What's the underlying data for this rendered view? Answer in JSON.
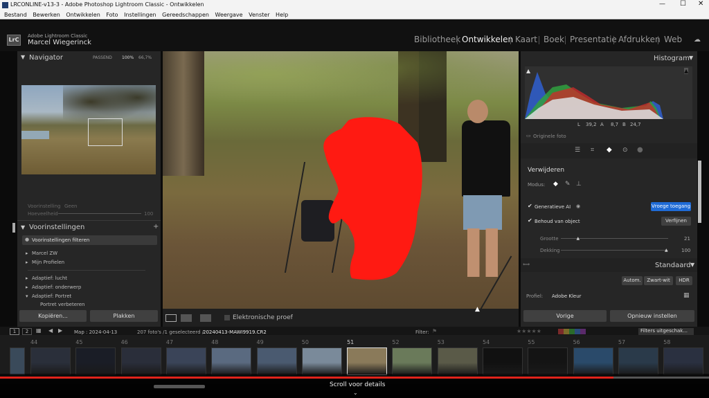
{
  "title": "LRCONLINE-v13-3 - Adobe Photoshop Lightroom Classic - Ontwikkelen",
  "menu": [
    "Bestand",
    "Bewerken",
    "Ontwikkelen",
    "Foto",
    "Instellingen",
    "Gereedschappen",
    "Weergave",
    "Venster",
    "Help"
  ],
  "app": {
    "product": "Adobe Lightroom Classic",
    "user": "Marcel Wiegerinck",
    "logo": "LrC"
  },
  "modules": [
    "Bibliotheek",
    "Ontwikkelen",
    "Kaart",
    "Boek",
    "Presentatie",
    "Afdrukken",
    "Web"
  ],
  "navigator": {
    "title": "Navigator",
    "fit": "PASSEND",
    "z1": "100%",
    "z2": "66,7%"
  },
  "preset_amount": {
    "voorinstelling_label": "Voorinstelling",
    "voorinstelling_value": "Geen",
    "hoeveelheid_label": "Hoeveelheid",
    "hoeveelheid_value": "100"
  },
  "presets": {
    "title": "Voorinstellingen",
    "filter": "Voorinstellingen filteren",
    "items": [
      "Marcel ZW",
      "Mijn Profielen",
      "Adaptief: lucht",
      "Adaptief: onderwerp",
      "Adaptief: Portret",
      "Portret verbeteren"
    ]
  },
  "left_buttons": {
    "copy": "Kopiëren...",
    "paste": "Plakken"
  },
  "toolbar": {
    "softproof": "Elektronische proef"
  },
  "histogram": {
    "title": "Histogram",
    "L_label": "L",
    "L": "39,2",
    "A_label": "A",
    "A": "8,7",
    "B_label": "B",
    "B": "24,7",
    "original": "Originele foto"
  },
  "remove": {
    "title": "Verwijderen",
    "mode": "Modus:",
    "genai": "Generatieve AI",
    "early": "Vroege toegang",
    "keep": "Behoud van object",
    "refine": "Verfijnen",
    "size_label": "Grootte",
    "size": "21",
    "size_frac": 0.15,
    "opacity_label": "Dekking",
    "opacity": "100",
    "opacity_frac": 1.0
  },
  "basic": {
    "title": "Standaard",
    "auto": "Autom.",
    "bw": "Zwart-wit",
    "hdr": "HDR",
    "profile_label": "Profiel:",
    "profile": "Adobe Kleur"
  },
  "right_buttons": {
    "prev": "Vorige",
    "reset": "Opnieuw instellen"
  },
  "filmbar": {
    "p1": "1",
    "p2": "2",
    "path": "Map : 2024-04-13",
    "count": "207 foto's /1 geselecteerd /",
    "file": "20240413-MAWI9919.CR2",
    "filter": "Filter:",
    "filter_off": "Filters uitgeschak..."
  },
  "thumb_numbers": [
    "44",
    "45",
    "46",
    "47",
    "48",
    "49",
    "50",
    "51",
    "52",
    "53",
    "54",
    "55",
    "56",
    "57",
    "58"
  ],
  "overlay": {
    "caption": "Scroll voor details",
    "progress": 0.865
  },
  "colors": {
    "accent": "#1f6bd6",
    "mask": "#ff1a12",
    "progress": "#e0231b"
  }
}
